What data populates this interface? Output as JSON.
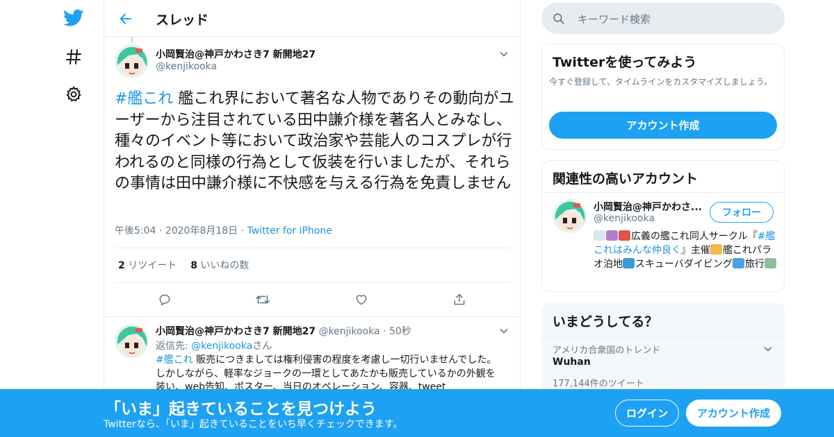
{
  "colors": {
    "accent": "#1da1f2",
    "link": "#1b95e0",
    "text": "#14171a",
    "muted": "#657786",
    "border": "#e6ecf0"
  },
  "nav": {
    "logo_icon": "twitter-bird-icon",
    "explore_icon": "hashtag-icon",
    "settings_icon": "gear-icon"
  },
  "header": {
    "title": "スレッド",
    "back_icon": "back-arrow-icon"
  },
  "main_tweet": {
    "author_name": "小岡賢治@神戸かわさき7 新開地27",
    "author_handle": "@kenjikooka",
    "hashtag": "#艦これ",
    "text": " 艦これ界において著名な人物でありその動向がユーザーから注目されている田中謙介様を著名人とみなし、種々のイベント等において政治家や芸能人のコスプレが行われるのと同様の行為として仮装を行いましたが、それらの事情は田中謙介様に不快感を与える行為を免責しません",
    "time": "午後5:04",
    "date": "2020年8月18日",
    "source": "Twitter for iPhone",
    "retweet_count": "2",
    "retweet_label": "リツイート",
    "like_count": "8",
    "like_label": "いいねの数"
  },
  "reply_tweet": {
    "author_name": "小岡賢治@神戸かわさき7 新開地27",
    "author_handle": "@kenjikooka",
    "time_ago": "50秒",
    "reply_to_prefix": "返信先: ",
    "reply_to_handle": "@kenjikooka",
    "reply_to_suffix": "さん",
    "hashtag": "#艦これ",
    "text": " 販売につきましては権利侵害の程度を考慮し一切行いませんでした。しかしながら、軽率なジョークの一環としてあたかも販売しているかの外観を装い、web告知、ポスター、当日のオペレーション、容器、tweet"
  },
  "search": {
    "placeholder": "キーワード検索"
  },
  "signup_card": {
    "title": "Twitterを使ってみよう",
    "description": "今すぐ登録して、タイムラインをカスタマイズしましょう。",
    "button": "アカウント作成"
  },
  "related_card": {
    "title": "関連性の高いアカウント",
    "account_name": "小岡賢治@神戸かわさ...",
    "account_handle": "@kenjikooka",
    "follow_label": "フォロー",
    "bio_part1": "広義の艦これ同人サークル『",
    "bio_hashtag": "#艦これはみんな仲良く",
    "bio_part2": "』主催",
    "bio_part3": "艦これパラオ泊地",
    "bio_part4": "スキューバダイビング",
    "bio_part5": "旅行"
  },
  "trends_card": {
    "title": "いまどうしてる？",
    "context": "アメリカ合衆国のトレンド",
    "name": "Wuhan",
    "count": "177,144件のツイート"
  },
  "banner": {
    "title": "「いま」起きていることを見つけよう",
    "subtitle": "Twitterなら、「いま」起きていることをいち早くチェックできます。",
    "login": "ログイン",
    "signup": "アカウント作成"
  }
}
